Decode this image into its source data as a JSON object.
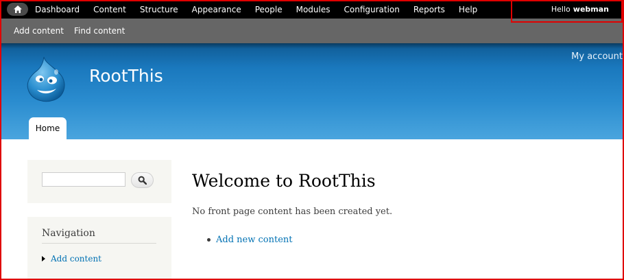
{
  "toolbar": {
    "home_icon": "home-icon",
    "menu": [
      "Dashboard",
      "Content",
      "Structure",
      "Appearance",
      "People",
      "Modules",
      "Configuration",
      "Reports",
      "Help"
    ],
    "hello_prefix": "Hello",
    "username": "webman"
  },
  "shortcuts": [
    "Add content",
    "Find content"
  ],
  "header": {
    "site_name": "RootThis",
    "my_account": "My account",
    "tabs": [
      "Home"
    ],
    "logo_icon": "drupal-drop-logo"
  },
  "sidebar": {
    "search_icon": "search-icon",
    "navigation_title": "Navigation",
    "navigation_items": [
      "Add content"
    ]
  },
  "main": {
    "title": "Welcome to RootThis",
    "message": "No front page content has been created yet.",
    "links": [
      "Add new content"
    ]
  },
  "colors": {
    "toolbar_bg": "#000000",
    "shortcut_bg": "#666666",
    "header_blue": "#1a78bd",
    "link": "#0071b3",
    "highlight": "#e00000"
  }
}
